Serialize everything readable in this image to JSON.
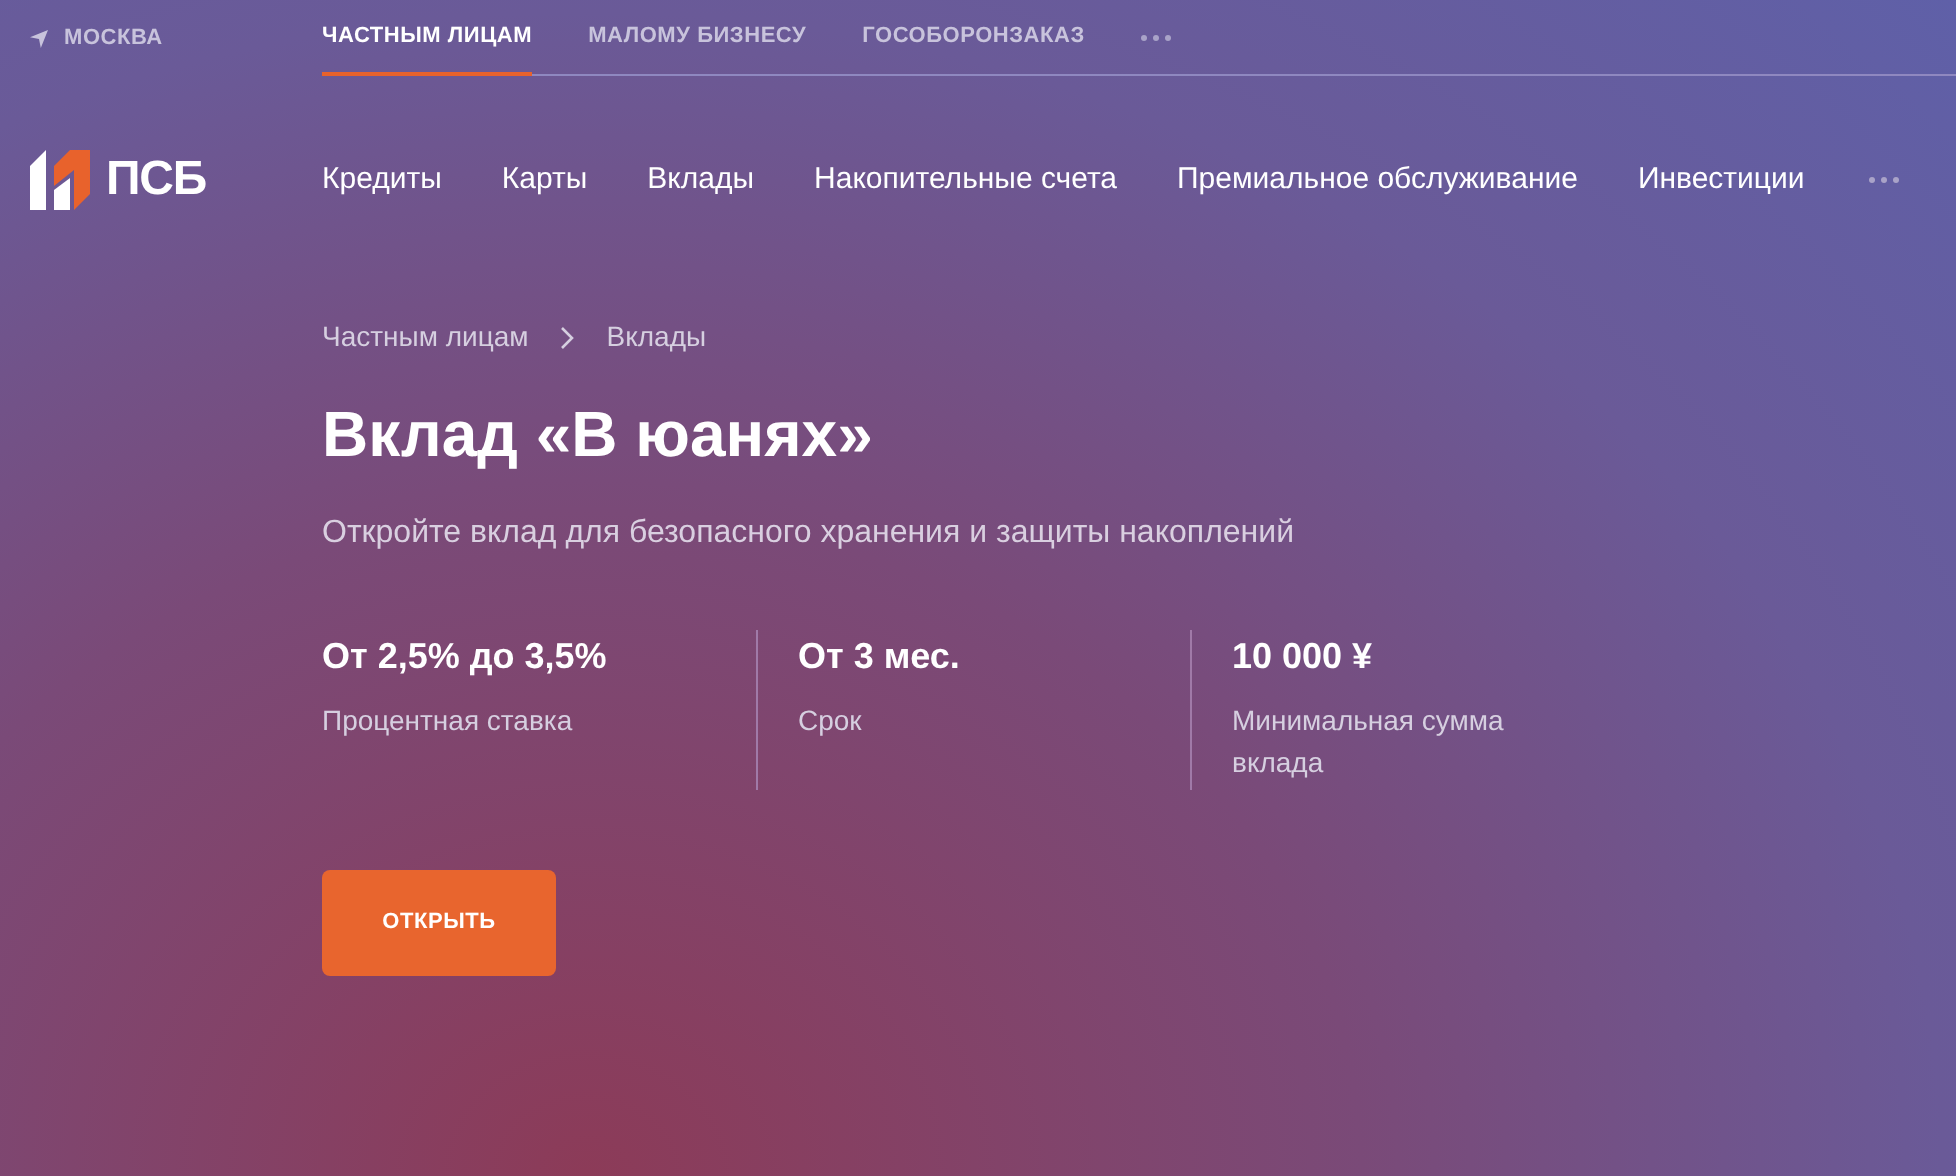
{
  "top_bar": {
    "city": "МОСКВА",
    "segments": [
      {
        "label": "ЧАСТНЫМ ЛИЦАМ",
        "selected": true
      },
      {
        "label": "МАЛОМУ БИЗНЕСУ",
        "selected": false
      },
      {
        "label": "ГОСОБОРОНЗАКАЗ",
        "selected": false
      }
    ]
  },
  "logo": {
    "text": "ПСБ"
  },
  "nav": [
    "Кредиты",
    "Карты",
    "Вклады",
    "Накопительные счета",
    "Премиальное обслуживание",
    "Инвестиции"
  ],
  "breadcrumbs": [
    "Частным лицам",
    "Вклады"
  ],
  "title": "Вклад «В юанях»",
  "subtitle": "Откройте вклад для безопасного хранения и защиты накоплений",
  "facts": [
    {
      "value": "От 2,5% до 3,5%",
      "label": "Процентная ставка"
    },
    {
      "value": "От 3 мес.",
      "label": "Срок"
    },
    {
      "value": "10 000 ¥",
      "label": "Минимальная сумма вклада"
    }
  ],
  "button": "ОТКРЫТЬ"
}
